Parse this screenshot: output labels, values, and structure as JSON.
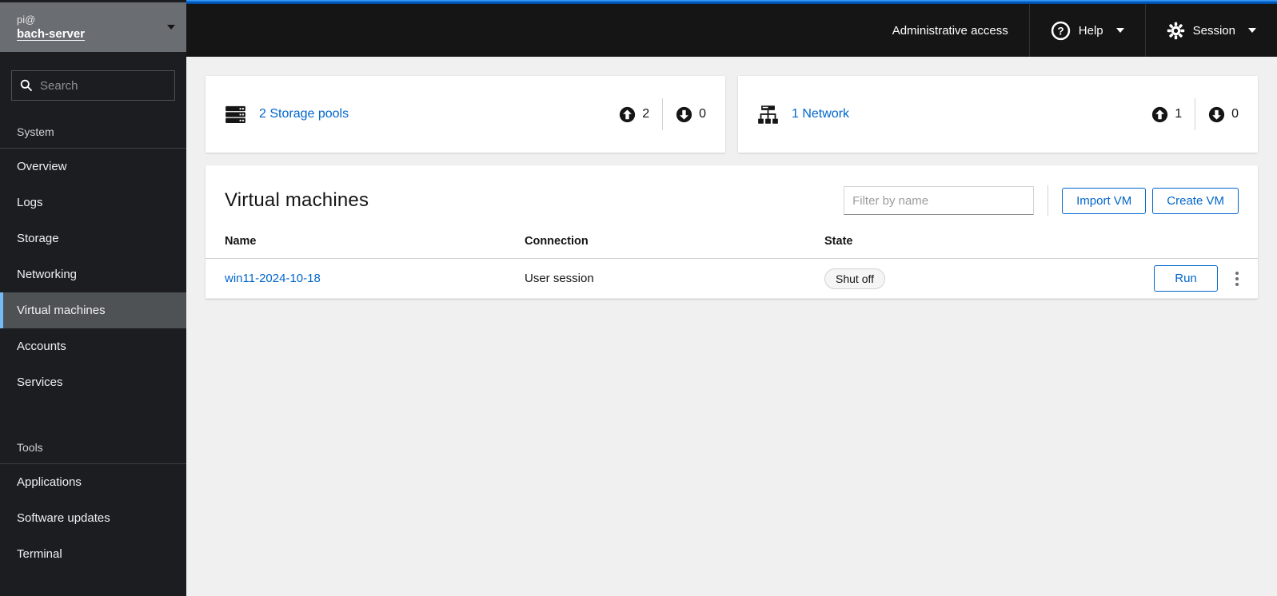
{
  "masthead": {
    "admin_access_label": "Administrative access",
    "help_label": "Help",
    "session_label": "Session"
  },
  "sidebar": {
    "user_line1": "pi@",
    "user_line2": "bach-server",
    "search_placeholder": "Search",
    "groups": [
      {
        "label": "System",
        "items": [
          {
            "label": "Overview",
            "selected": false
          },
          {
            "label": "Logs",
            "selected": false
          },
          {
            "label": "Storage",
            "selected": false
          },
          {
            "label": "Networking",
            "selected": false
          },
          {
            "label": "Virtual machines",
            "selected": true
          },
          {
            "label": "Accounts",
            "selected": false
          },
          {
            "label": "Services",
            "selected": false
          }
        ]
      },
      {
        "label": "Tools",
        "items": [
          {
            "label": "Applications",
            "selected": false
          },
          {
            "label": "Software updates",
            "selected": false
          },
          {
            "label": "Terminal",
            "selected": false
          }
        ]
      }
    ]
  },
  "overview_cards": [
    {
      "icon": "storage-pools-icon",
      "link_label": "2 Storage pools",
      "up_count": "2",
      "down_count": "0"
    },
    {
      "icon": "network-icon",
      "link_label": "1 Network",
      "up_count": "1",
      "down_count": "0"
    }
  ],
  "vm_section": {
    "title": "Virtual machines",
    "filter_placeholder": "Filter by name",
    "import_vm_label": "Import VM",
    "create_vm_label": "Create VM",
    "table": {
      "headers": [
        "Name",
        "Connection",
        "State"
      ],
      "rows": [
        {
          "name": "win11-2024-10-18",
          "connection": "User session",
          "state": "Shut off",
          "action_label": "Run"
        }
      ]
    }
  },
  "colors": {
    "accent_blue": "#0066cc",
    "selected_indicator": "#73bcf7",
    "masthead_bg": "#151515",
    "sidebar_bg": "#1b1d21",
    "content_bg": "#f0f0f0"
  }
}
